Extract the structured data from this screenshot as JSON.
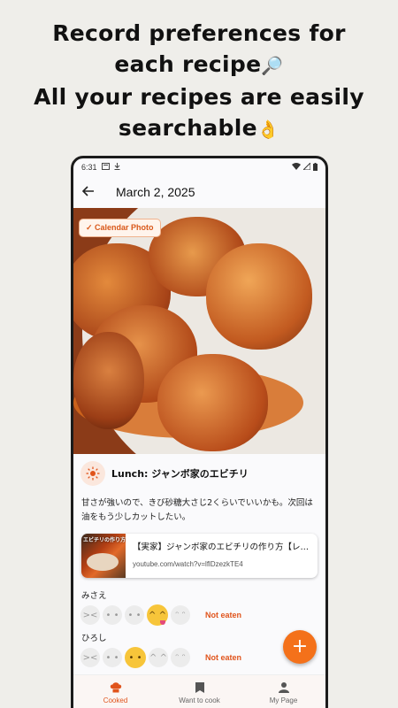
{
  "promo": {
    "line1": "Record preferences for",
    "line2": "each recipe",
    "line2_emoji": "🔎",
    "line3": "All your recipes are easily",
    "line4": "searchable",
    "line4_emoji": "👌"
  },
  "status_bar": {
    "time": "6:31"
  },
  "app_bar": {
    "date": "March 2, 2025"
  },
  "photo": {
    "chip_label": "✓ Calendar Photo"
  },
  "meal": {
    "title": "Lunch: ジャンボ家のエビチリ",
    "note": "甘さが強いので、きび砂糖大さじ2くらいでいいかも。次回は油をもう少しカットしたい。"
  },
  "link_card": {
    "thumb_text": "エビチリの作り方",
    "title": "【実家】ジャンボ家のエビチリの作り方【レ…",
    "url": "youtube.com/watch?v=lflDzezkTE4"
  },
  "ratings": [
    {
      "person": "みさえ",
      "selected_index": 3,
      "not_eaten_label": "Not eaten"
    },
    {
      "person": "ひろし",
      "selected_index": 2,
      "not_eaten_label": "Not eaten"
    }
  ],
  "bottom_nav": {
    "items": [
      {
        "label": "Cooked",
        "icon": "chef-hat-icon",
        "active": true
      },
      {
        "label": "Want to cook",
        "icon": "bookmark-icon",
        "active": false
      },
      {
        "label": "My Page",
        "icon": "person-icon",
        "active": false
      }
    ]
  },
  "colors": {
    "accent": "#f4711a",
    "accent_text": "#e0541c",
    "background": "#efeeea"
  }
}
